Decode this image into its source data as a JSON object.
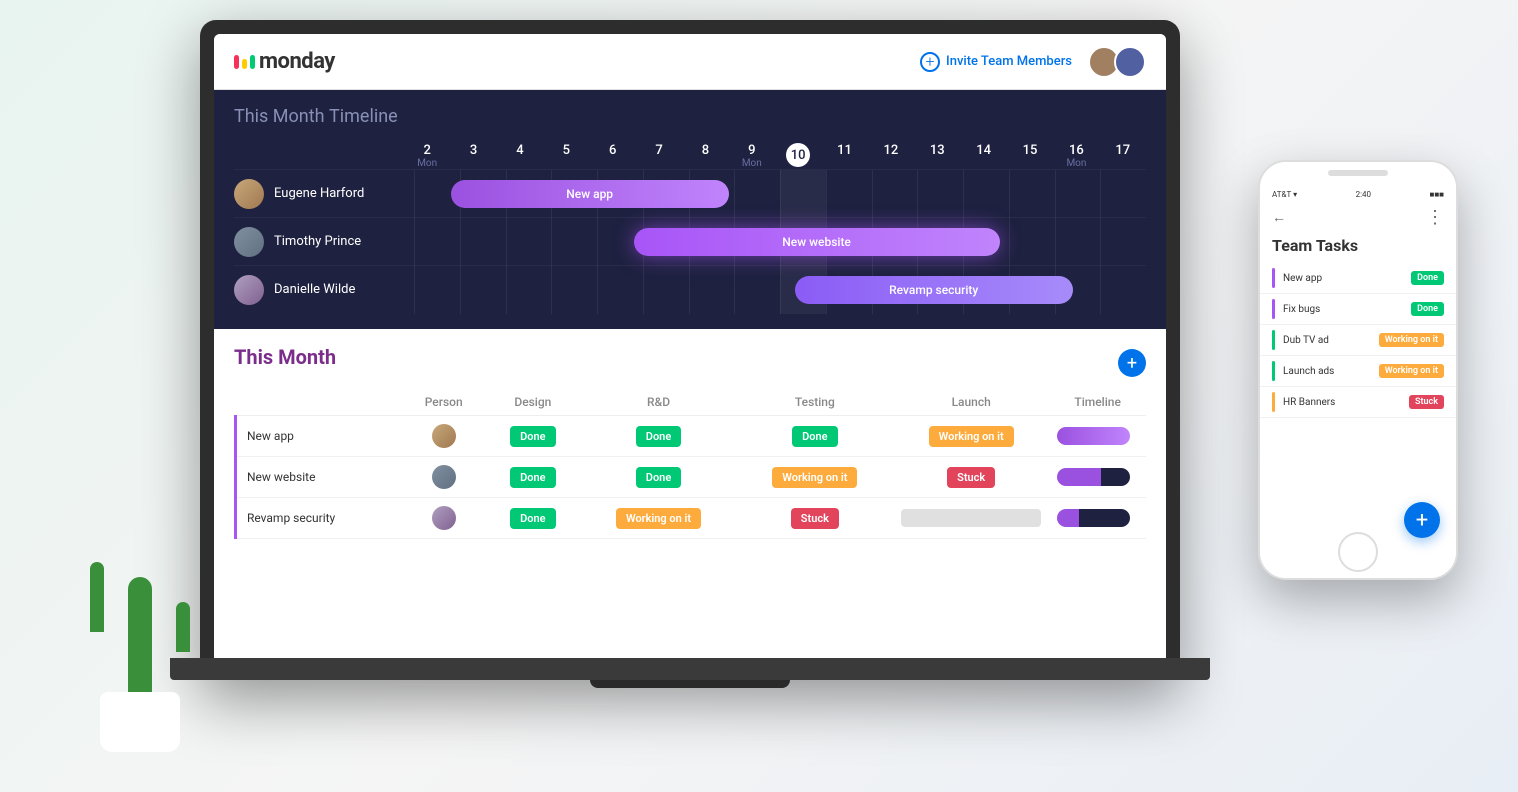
{
  "app": {
    "title": "monday",
    "invite_btn": "Invite Team Members"
  },
  "timeline": {
    "section_title": "This Month",
    "section_subtitle": "Timeline",
    "days": [
      {
        "num": "2",
        "label": "Mon"
      },
      {
        "num": "3",
        "label": ""
      },
      {
        "num": "4",
        "label": ""
      },
      {
        "num": "5",
        "label": ""
      },
      {
        "num": "6",
        "label": ""
      },
      {
        "num": "7",
        "label": ""
      },
      {
        "num": "8",
        "label": ""
      },
      {
        "num": "9",
        "label": "Mon"
      },
      {
        "num": "10",
        "label": "",
        "today": true
      },
      {
        "num": "11",
        "label": ""
      },
      {
        "num": "12",
        "label": ""
      },
      {
        "num": "13",
        "label": ""
      },
      {
        "num": "14",
        "label": ""
      },
      {
        "num": "15",
        "label": ""
      },
      {
        "num": "16",
        "label": "Mon"
      },
      {
        "num": "17",
        "label": ""
      }
    ],
    "rows": [
      {
        "person": "Eugene Harford",
        "task": "New app"
      },
      {
        "person": "Timothy Prince",
        "task": "New website"
      },
      {
        "person": "Danielle Wilde",
        "task": "Revamp security"
      }
    ]
  },
  "table": {
    "month_title": "This Month",
    "columns": [
      "Person",
      "Design",
      "R&D",
      "Testing",
      "Launch",
      "Timeline"
    ],
    "rows": [
      {
        "task": "New app",
        "design": "Done",
        "rd": "Done",
        "testing": "Done",
        "launch": "Working on it",
        "design_status": "done",
        "rd_status": "done",
        "testing_status": "done",
        "launch_status": "working"
      },
      {
        "task": "New website",
        "design": "Done",
        "rd": "Done",
        "testing": "Working on it",
        "launch": "Stuck",
        "design_status": "done",
        "rd_status": "done",
        "testing_status": "working",
        "launch_status": "stuck"
      },
      {
        "task": "Revamp security",
        "design": "Done",
        "rd": "Working on it",
        "testing": "Stuck",
        "launch": "",
        "design_status": "done",
        "rd_status": "working",
        "testing_status": "stuck",
        "launch_status": "gray"
      }
    ]
  },
  "phone": {
    "title": "Team Tasks",
    "tasks": [
      {
        "name": "New app",
        "status": "Done",
        "status_type": "done",
        "color": "#a855f7"
      },
      {
        "name": "Fix bugs",
        "status": "Done",
        "status_type": "done",
        "color": "#a855f7"
      },
      {
        "name": "Dub TV ad",
        "status": "Working on it",
        "status_type": "working",
        "color": "#00c875"
      },
      {
        "name": "Launch ads",
        "status": "Working on it",
        "status_type": "working",
        "color": "#00c875"
      },
      {
        "name": "HR Banners",
        "status": "Stuck",
        "status_type": "stuck",
        "color": "#fdab3d"
      }
    ]
  }
}
